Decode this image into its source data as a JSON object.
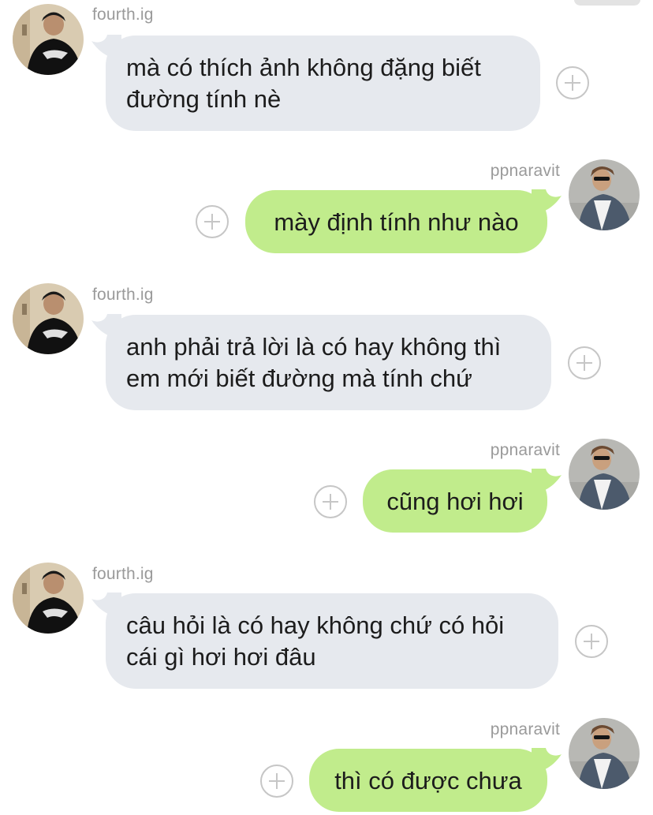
{
  "messages": [
    {
      "sender": "fourth.ig",
      "direction": "in",
      "lines": [
        "mà có thích ảnh không đặng biết",
        "đường tính nè"
      ]
    },
    {
      "sender": "ppnaravit",
      "direction": "out",
      "lines": [
        "mày định tính như nào"
      ]
    },
    {
      "sender": "fourth.ig",
      "direction": "in",
      "lines": [
        "anh phải trả lời là có hay không thì",
        "em mới biết đường mà tính chứ"
      ]
    },
    {
      "sender": "ppnaravit",
      "direction": "out",
      "lines": [
        "cũng hơi hơi"
      ]
    },
    {
      "sender": "fourth.ig",
      "direction": "in",
      "lines": [
        "câu hỏi là có hay không chứ có hỏi",
        "cái gì hơi hơi đâu"
      ]
    },
    {
      "sender": "ppnaravit",
      "direction": "out",
      "lines": [
        "thì có được chưa"
      ]
    }
  ],
  "colors": {
    "incoming_bubble": "#e6e9ee",
    "outgoing_bubble": "#c1ec8c",
    "sender_name": "#9a9a9a",
    "plus_icon": "#c6c6c6"
  },
  "icons": {
    "reaction_button": "plus-circle-icon"
  }
}
